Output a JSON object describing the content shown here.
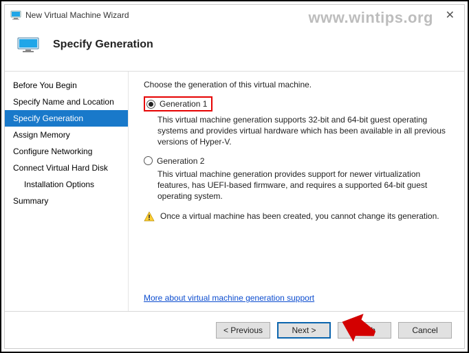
{
  "window": {
    "title": "New Virtual Machine Wizard",
    "watermark": "www.wintips.org"
  },
  "header": {
    "title": "Specify Generation"
  },
  "sidebar": {
    "items": [
      {
        "label": "Before You Begin"
      },
      {
        "label": "Specify Name and Location"
      },
      {
        "label": "Specify Generation"
      },
      {
        "label": "Assign Memory"
      },
      {
        "label": "Configure Networking"
      },
      {
        "label": "Connect Virtual Hard Disk"
      },
      {
        "label": "Installation Options"
      },
      {
        "label": "Summary"
      }
    ],
    "selected_index": 2
  },
  "main": {
    "intro": "Choose the generation of this virtual machine.",
    "options": [
      {
        "label": "Generation 1",
        "desc": "This virtual machine generation supports 32-bit and 64-bit guest operating systems and provides virtual hardware which has been available in all previous versions of Hyper-V.",
        "selected": true
      },
      {
        "label": "Generation 2",
        "desc": "This virtual machine generation provides support for newer virtualization features, has UEFI-based firmware, and requires a supported 64-bit guest operating system.",
        "selected": false
      }
    ],
    "warning": "Once a virtual machine has been created, you cannot change its generation.",
    "link": "More about virtual machine generation support"
  },
  "footer": {
    "previous": "< Previous",
    "next": "Next >",
    "finish": "Finish",
    "cancel": "Cancel"
  }
}
